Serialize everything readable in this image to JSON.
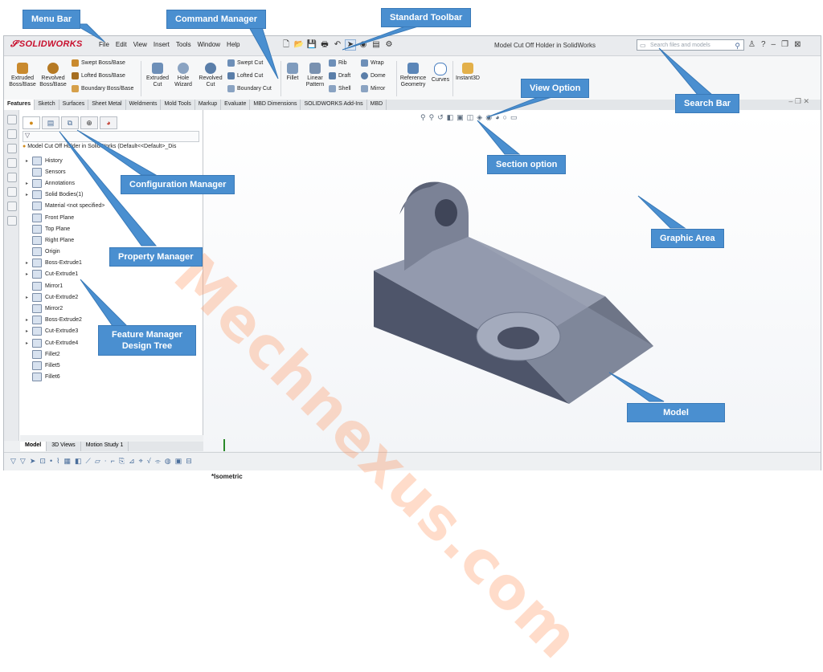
{
  "app": {
    "brand": "SOLIDWORKS",
    "document_title": "Model Cut Off Holder in SolidWorks"
  },
  "menu": [
    "File",
    "Edit",
    "View",
    "Insert",
    "Tools",
    "Window",
    "Help"
  ],
  "search": {
    "placeholder": "Search files and models"
  },
  "command_manager": {
    "extruded_boss": "Extruded Boss/Base",
    "revolved_boss": "Revolved Boss/Base",
    "swept_boss": "Swept Boss/Base",
    "lofted_boss": "Lofted Boss/Base",
    "boundary_boss": "Boundary Boss/Base",
    "extruded_cut": "Extruded Cut",
    "hole_wizard": "Hole Wizard",
    "revolved_cut": "Revolved Cut",
    "swept_cut": "Swept Cut",
    "lofted_cut": "Lofted Cut",
    "boundary_cut": "Boundary Cut",
    "fillet": "Fillet",
    "linear_pattern": "Linear Pattern",
    "rib": "Rib",
    "draft": "Draft",
    "shell": "Shell",
    "wrap": "Wrap",
    "dome": "Dome",
    "mirror": "Mirror",
    "reference_geometry": "Reference Geometry",
    "curves": "Curves",
    "instant3d": "Instant3D"
  },
  "tabs": [
    "Features",
    "Sketch",
    "Surfaces",
    "Sheet Metal",
    "Weldments",
    "Mold Tools",
    "Markup",
    "Evaluate",
    "MBD Dimensions",
    "SOLIDWORKS Add-Ins",
    "MBD"
  ],
  "tree": {
    "root": "Model Cut Off Holder in SolidWorks (Default<<Default>_Dis",
    "items": [
      {
        "label": "History",
        "exp": "▸"
      },
      {
        "label": "Sensors",
        "exp": ""
      },
      {
        "label": "Annotations",
        "exp": "▸"
      },
      {
        "label": "Solid Bodies(1)",
        "exp": "▸"
      },
      {
        "label": "Material <not specified>",
        "exp": ""
      },
      {
        "label": "Front Plane",
        "exp": ""
      },
      {
        "label": "Top Plane",
        "exp": ""
      },
      {
        "label": "Right Plane",
        "exp": ""
      },
      {
        "label": "Origin",
        "exp": ""
      },
      {
        "label": "Boss-Extrude1",
        "exp": "▸"
      },
      {
        "label": "Cut-Extrude1",
        "exp": "▸"
      },
      {
        "label": "Mirror1",
        "exp": ""
      },
      {
        "label": "Cut-Extrude2",
        "exp": "▸"
      },
      {
        "label": "Mirror2",
        "exp": ""
      },
      {
        "label": "Boss-Extrude2",
        "exp": "▸"
      },
      {
        "label": "Cut-Extrude3",
        "exp": "▸"
      },
      {
        "label": "Cut-Extrude4",
        "exp": "▸"
      },
      {
        "label": "Fillet2",
        "exp": ""
      },
      {
        "label": "Fillet5",
        "exp": ""
      },
      {
        "label": "Fillet6",
        "exp": ""
      }
    ]
  },
  "bottom_tabs": [
    "Model",
    "3D Views",
    "Motion Study 1"
  ],
  "view_label": "*Isometric",
  "callouts": {
    "menu_bar": "Menu Bar",
    "command_manager": "Command Manager",
    "standard_toolbar": "Standard Toolbar",
    "view_option": "View Option",
    "search_bar": "Search Bar",
    "section_option": "Section option",
    "configuration_manager": "Configuration Manager",
    "graphic_area": "Graphic Area",
    "property_manager": "Property Manager",
    "feature_manager": "Feature Manager Design Tree",
    "model": "Model"
  },
  "watermark": "Mechnexus.com",
  "colors": {
    "callout": "#4a8fd0",
    "brand": "#c8102e",
    "model": "#5c6478"
  }
}
